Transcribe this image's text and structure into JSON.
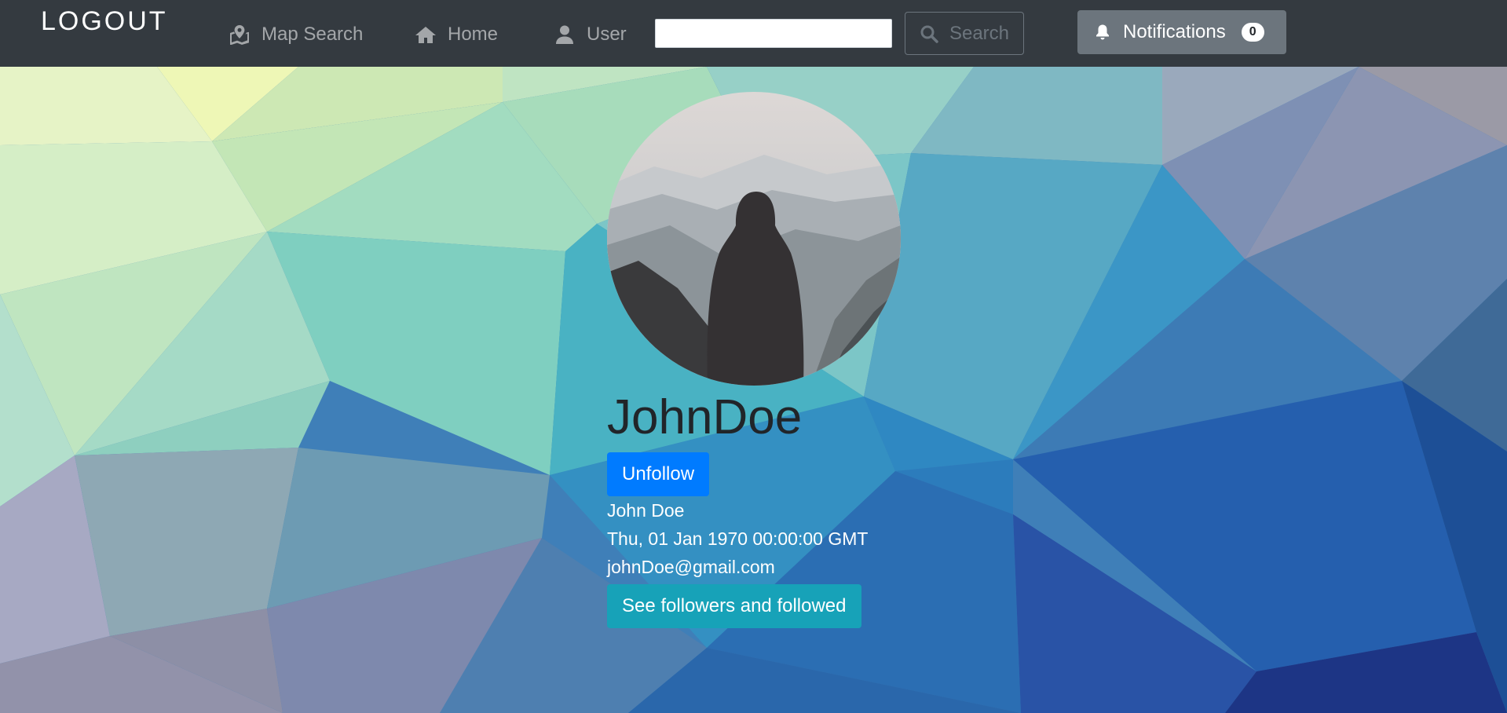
{
  "navbar": {
    "brand": "LOGOUT",
    "links": [
      {
        "label": "Map Search",
        "icon": "map-marked-icon"
      },
      {
        "label": "Home",
        "icon": "home-icon"
      },
      {
        "label": "User",
        "icon": "user-icon"
      }
    ],
    "search": {
      "value": "",
      "placeholder": "",
      "button_label": "Search"
    },
    "notifications": {
      "label": "Notifications",
      "count": "0"
    }
  },
  "profile": {
    "avatar": "hooded-figure-mountains-photo",
    "username": "JohnDoe",
    "unfollow_label": "Unfollow",
    "full_name": "John Doe",
    "date": "Thu, 01 Jan 1970 00:00:00 GMT",
    "email": "johnDoe@gmail.com",
    "followers_label": "See followers and followed"
  },
  "colors": {
    "navbar": "#343a40",
    "primary": "#007bff",
    "info": "#17a2b8",
    "secondary": "#6c757d"
  }
}
